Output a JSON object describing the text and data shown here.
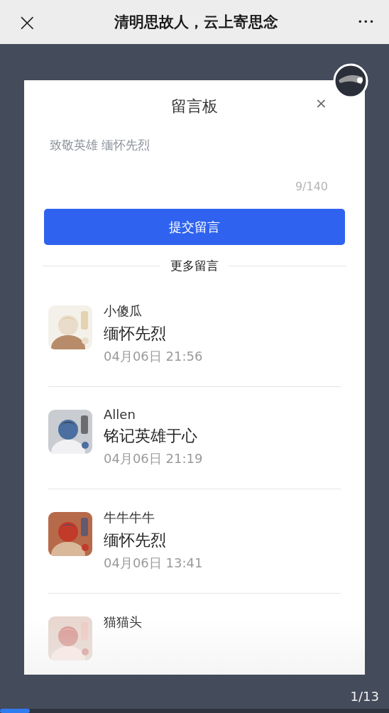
{
  "top_bar": {
    "close": "×",
    "title": "清明思故人，云上寄思念",
    "more": "•••"
  },
  "board": {
    "title": "留言板",
    "close": "×",
    "input": {
      "value": "致敬英雄 缅怀先烈",
      "counter": "9/140"
    },
    "submit": "提交留言",
    "more_label": "更多留言",
    "comments": [
      {
        "name": "小傻瓜",
        "message": "缅怀先烈",
        "time": "04月06日 21:56"
      },
      {
        "name": "Allen",
        "message": "铭记英雄于心",
        "time": "04月06日 21:19"
      },
      {
        "name": "牛牛牛牛",
        "message": "缅怀先烈",
        "time": "04月06日 13:41"
      },
      {
        "name": "猫猫头"
      }
    ]
  },
  "pager": {
    "counter": "1/13",
    "level": 0.077
  }
}
